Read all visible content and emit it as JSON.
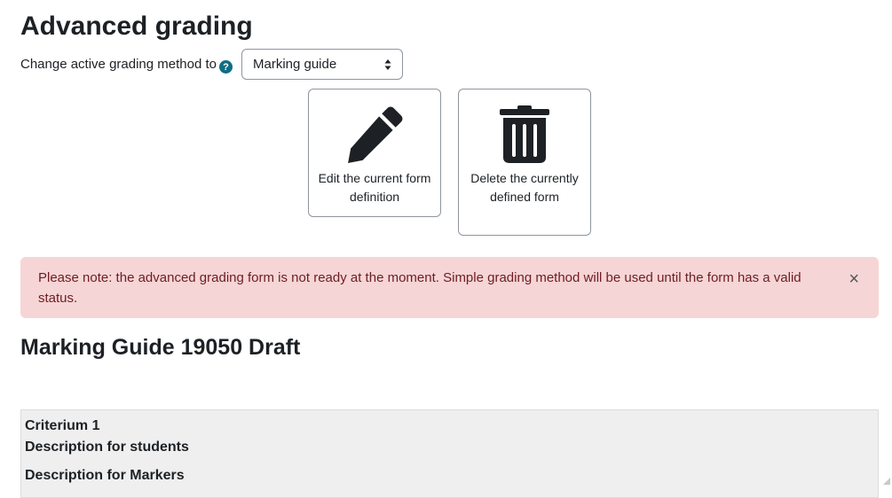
{
  "page": {
    "title": "Advanced grading"
  },
  "method": {
    "label": "Change active grading method to",
    "help_icon": "question-circle-icon",
    "selected": "Marking guide"
  },
  "actions": [
    {
      "icon": "pencil-icon",
      "label": "Edit the current form definition"
    },
    {
      "icon": "trash-icon",
      "label": "Delete the currently defined form"
    }
  ],
  "alert": {
    "message": "Please note: the advanced grading form is not ready at the moment. Simple grading method will be used until the form has a valid status.",
    "close_symbol": "×",
    "color": "#f6d5d6"
  },
  "guide": {
    "title": "Marking Guide 19050 Draft",
    "criterion": {
      "name": "Criterium 1",
      "students_label": "Description for students",
      "markers_label": "Description for Markers"
    }
  },
  "colors": {
    "accent": "#0f6e84",
    "text": "#1d2125",
    "alert_text": "#6e1d22"
  }
}
